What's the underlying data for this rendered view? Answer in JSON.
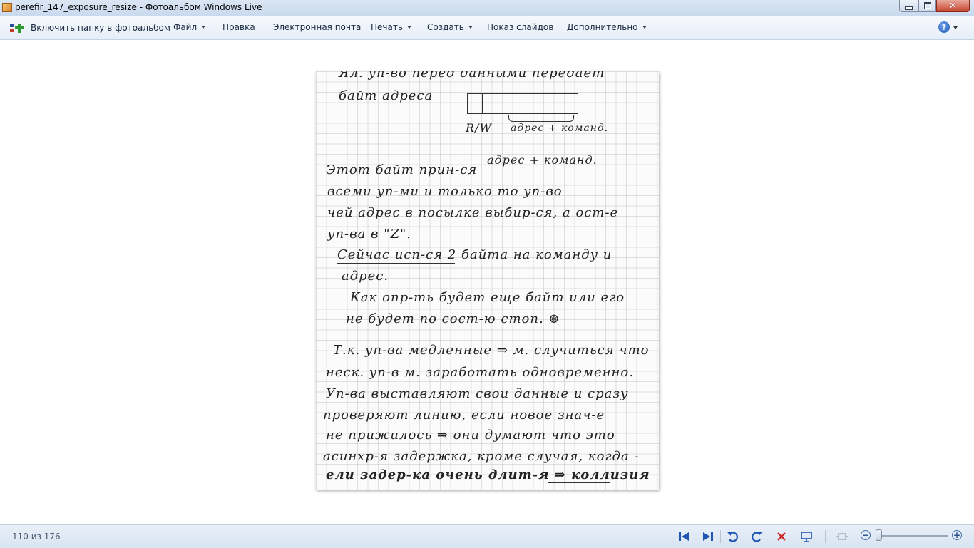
{
  "window": {
    "title": "perefir_147_exposure_resize - Фотоальбом Windows Live",
    "minimize_glyph": "",
    "close_glyph": "✕"
  },
  "menu": {
    "items": [
      {
        "label": "Включить папку в фотоальбом",
        "has_dropdown": false
      },
      {
        "label": "Файл",
        "has_dropdown": true
      },
      {
        "label": "Правка",
        "has_dropdown": false
      },
      {
        "label": "Электронная почта",
        "has_dropdown": false
      },
      {
        "label": "Печать",
        "has_dropdown": true
      },
      {
        "label": "Создать",
        "has_dropdown": true
      },
      {
        "label": "Показ слайдов",
        "has_dropdown": false
      },
      {
        "label": "Дополнительно",
        "has_dropdown": true
      }
    ],
    "help_glyph": "?"
  },
  "photo": {
    "lines": [
      "Ял. уп-во перед данными передает",
      "байт адреса",
      "R/W",
      "адрес + команд.",
      "адрес + команд.",
      "Этот байт прин-ся",
      "всеми уп-ми и только то уп-во",
      "чей адрес в посылке выбир-ся, а ост-е",
      "уп-ва в \"Z\".",
      "Сейчас исп-ся 2 байта на команду и",
      "адрес.",
      "Как опр-ть будет еще байт или его",
      "не будет по сост-ю стоп. ⊛",
      "Т.к. уп-ва медленные ⇒ м. случиться что",
      "неск. уп-в м. заработать одновременно.",
      "Уп-ва выставляют свои данные и сразу",
      "проверяют линию, если новое знач-е",
      "не прижилось ⇒ они думают что это",
      "асинхр-я задержка, кроме случая, когда -",
      "ели задер-ка очень длит-я ⇒ коллизия"
    ]
  },
  "status": {
    "counter": "110 из 176"
  },
  "toolbar": {
    "prev_icon": "previous-icon",
    "next_icon": "next-icon",
    "rotate_left_icon": "rotate-left-icon",
    "rotate_right_icon": "rotate-right-icon",
    "delete_icon": "delete-icon",
    "slideshow_icon": "slideshow-icon",
    "fit_icon": "fit-icon",
    "zoom_out_label": "−",
    "zoom_in_label": "+",
    "zoom_level_fraction": 0.02
  },
  "colors": {
    "blue_icon": "#1f56b3",
    "delete_red": "#d02b2b"
  }
}
